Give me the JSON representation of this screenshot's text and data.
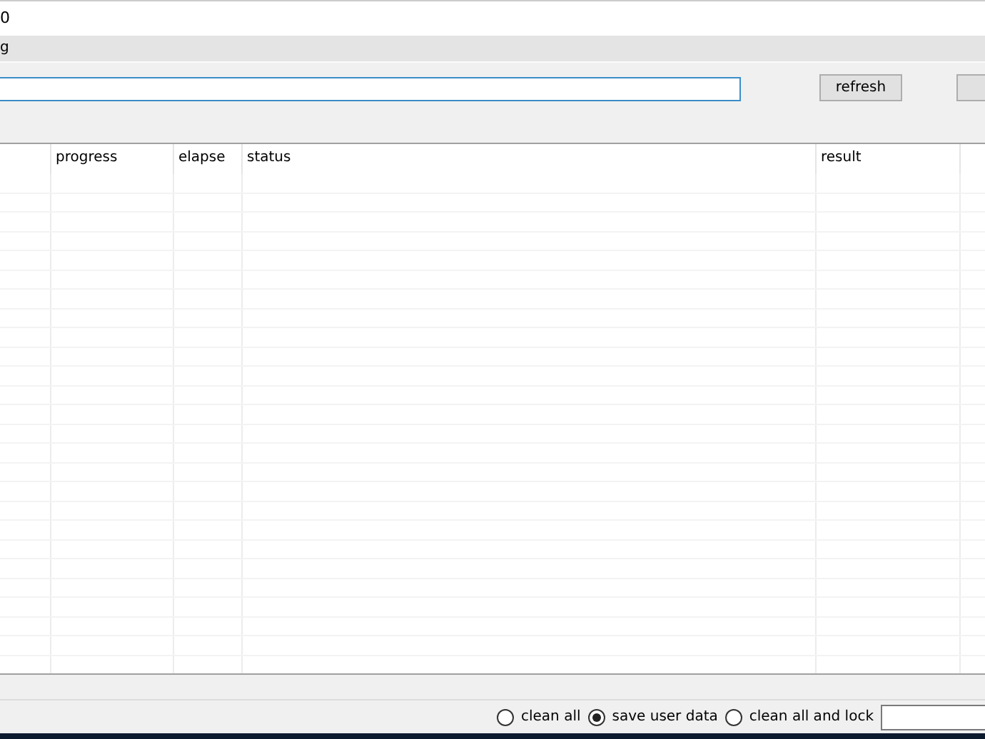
{
  "window": {
    "title": "0"
  },
  "menu": {
    "items": [
      "g"
    ]
  },
  "toolbar": {
    "refresh_button": "refresh"
  },
  "table": {
    "columns": [
      "",
      "progress",
      "elapse",
      "status",
      "result",
      ""
    ]
  },
  "options": [
    {
      "label": "clean all",
      "selected": false
    },
    {
      "label": "save user data",
      "selected": true
    },
    {
      "label": "clean all and lock",
      "selected": false
    }
  ]
}
